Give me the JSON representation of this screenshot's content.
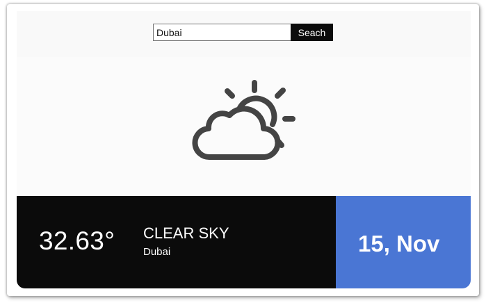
{
  "search": {
    "value": "Dubai",
    "button_label": "Seach"
  },
  "weather": {
    "icon": "partly-cloudy-icon",
    "temperature": "32.63°",
    "description": "CLEAR SKY",
    "city": "Dubai",
    "date": "15, Nov"
  },
  "colors": {
    "info_panel": "#0b0b0b",
    "date_panel": "#4a76d4",
    "icon_stroke": "#444444"
  }
}
